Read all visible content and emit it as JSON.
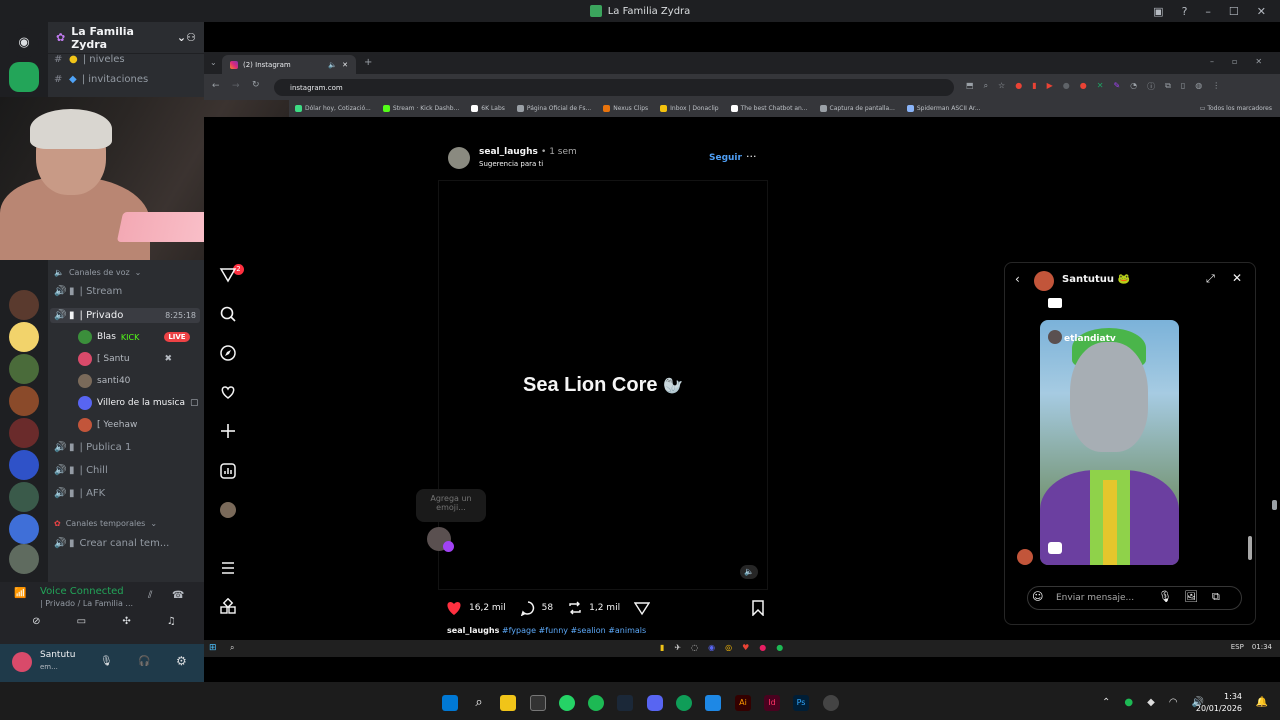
{
  "window": {
    "title": "La Familia Zydra"
  },
  "server": {
    "name": "La Familia Zydra"
  },
  "channels": {
    "top": [
      {
        "label": "| niveles"
      },
      {
        "label": "| invitaciones"
      }
    ],
    "voice_header": "Canales de voz",
    "voice": [
      {
        "label": "| Stream"
      },
      {
        "label": "| Privado",
        "time": "8:25:18"
      },
      {
        "label": "| Publica 1"
      },
      {
        "label": "| Chill"
      },
      {
        "label": "| AFK"
      }
    ],
    "members": [
      {
        "name": "Blas",
        "extra": "KICK",
        "badge": "LIVE"
      },
      {
        "name": "[ Santu"
      },
      {
        "name": "santi40"
      },
      {
        "name": "Villero de la musica"
      },
      {
        "name": "[ Yeehaw"
      }
    ],
    "temp_header": "Canales temporales",
    "temp": [
      {
        "label": "Crear canal tem..."
      }
    ]
  },
  "voice_panel": {
    "status": "Voice Connected",
    "location": "| Privado / La Familia ...",
    "user": "Santutu",
    "user_status": "em..."
  },
  "browser": {
    "tab_title": "(2) Instagram",
    "url": "instagram.com",
    "bookmarks": [
      {
        "label": "Dólar hoy, Cotizació...",
        "color": "#3ddc84"
      },
      {
        "label": "Stream · Kick Dashb...",
        "color": "#53fc18"
      },
      {
        "label": "6K Labs",
        "color": "#ffffff"
      },
      {
        "label": "Página Oficial de Fs...",
        "color": "#9aa0a6"
      },
      {
        "label": "Nexus Clips",
        "color": "#e8730c"
      },
      {
        "label": "Inbox | Donaclip",
        "color": "#f4c20d"
      },
      {
        "label": "The best Chatbot an...",
        "color": "#ffffff"
      },
      {
        "label": "Captura de pantalla...",
        "color": "#9aa0a6"
      },
      {
        "label": "Spiderman ASCII Ar...",
        "color": "#8ab4f8"
      }
    ],
    "all_bookmarks": "Todos los marcadores"
  },
  "post": {
    "username": "seal_laughs",
    "time": "• 1 sem",
    "suggestion": "Sugerencia para ti",
    "follow": "Seguir",
    "text": "Sea Lion Core",
    "likes": "16,2 mil",
    "comments": "58",
    "shares": "1,2 mil",
    "caption_user": "seal_laughs",
    "caption_tags": "#fypage #funny #sealion #animals",
    "emoji_tip": "Agrega un emoji..."
  },
  "dm": {
    "name": "Santutuu 🐸",
    "reel_account": "etlandiatv",
    "placeholder": "Enviar mensaje..."
  },
  "nav_badge": "2",
  "taskbar": {
    "lang": "ESP",
    "clock_small": "01:34",
    "time": "1:34",
    "date": "20/01/2026"
  },
  "colors": {
    "discord_bg": "#2b2d31",
    "instagram_blue": "#4f9ff5",
    "like_red": "#ff3040",
    "live_red": "#ed4245"
  }
}
